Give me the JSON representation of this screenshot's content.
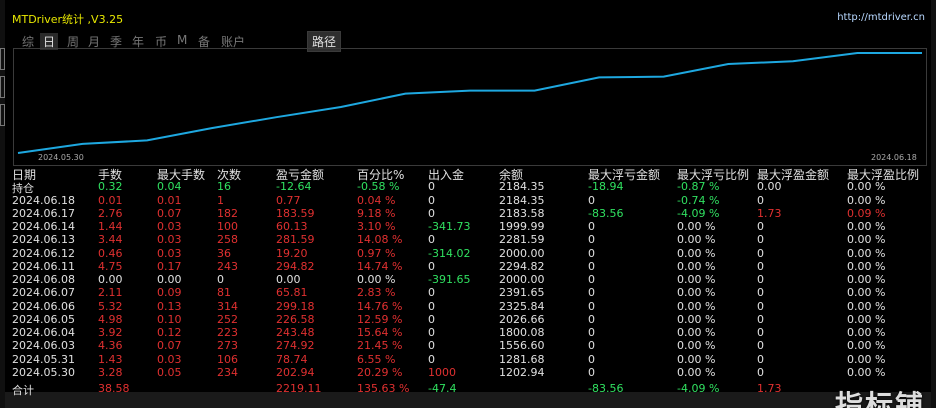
{
  "window": {
    "title": "MTDriver统计 ,V3.25",
    "url": "http://mtdriver.cn"
  },
  "periods": [
    {
      "label": "综",
      "active": false
    },
    {
      "label": "日",
      "active": true
    },
    {
      "label": "周",
      "active": false
    },
    {
      "label": "月",
      "active": false
    },
    {
      "label": "季",
      "active": false
    },
    {
      "label": "年",
      "active": false
    },
    {
      "label": "币",
      "active": false
    },
    {
      "label": "M",
      "active": false
    },
    {
      "label": "备",
      "active": false
    },
    {
      "label": "账户",
      "active": false
    }
  ],
  "path_label": "路径",
  "colors": {
    "line": "#1ea8e0",
    "profit": "#e03030",
    "loss": "#30e060",
    "neutral": "#e0e0e0"
  },
  "chart_data": {
    "type": "line",
    "x_start_label": "2024.05.30",
    "x_end_label": "2024.06.18",
    "series": [
      {
        "x": [
          "2024.05.30",
          "2024.05.31",
          "2024.06.03",
          "2024.06.04",
          "2024.06.05",
          "2024.06.06",
          "2024.06.07",
          "2024.06.08",
          "2024.06.11",
          "2024.06.12",
          "2024.06.13",
          "2024.06.14",
          "2024.06.17",
          "2024.06.18"
        ],
        "values": [
          1202.94,
          1281.68,
          1556.6,
          1800.08,
          2026.66,
          2325.84,
          2391.65,
          2000.0,
          2294.82,
          2000.0,
          2281.59,
          1999.99,
          2183.58,
          2184.35
        ]
      }
    ]
  },
  "table": {
    "headers": [
      "日期",
      "手数",
      "最大手数",
      "次数",
      "盈亏金额",
      "百分比%",
      "出入金",
      "余额",
      "最大浮亏金额",
      "最大浮亏比例",
      "最大浮盈金额",
      "最大浮盈比例"
    ],
    "holding": {
      "label": "持仓",
      "cells": [
        "0.32",
        "0.04",
        "16",
        "-12.64",
        "-0.58 %",
        "0",
        "2184.35",
        "-18.94",
        "-0.87 %",
        "0.00",
        "0.00 %"
      ]
    },
    "rows": [
      {
        "date": "2024.06.18",
        "cells": [
          "0.01",
          "0.01",
          "1",
          "0.77",
          "0.04 %",
          "0",
          "2184.35",
          "0",
          "-0.74 %",
          "0",
          "0.00 %"
        ]
      },
      {
        "date": "2024.06.17",
        "cells": [
          "2.76",
          "0.07",
          "182",
          "183.59",
          "9.18 %",
          "0",
          "2183.58",
          "-83.56",
          "-4.09 %",
          "1.73",
          "0.09 %"
        ]
      },
      {
        "date": "2024.06.14",
        "cells": [
          "1.44",
          "0.03",
          "100",
          "60.13",
          "3.10 %",
          "-341.73",
          "1999.99",
          "0",
          "0.00 %",
          "0",
          "0.00 %"
        ]
      },
      {
        "date": "2024.06.13",
        "cells": [
          "3.44",
          "0.03",
          "258",
          "281.59",
          "14.08 %",
          "0",
          "2281.59",
          "0",
          "0.00 %",
          "0",
          "0.00 %"
        ]
      },
      {
        "date": "2024.06.12",
        "cells": [
          "0.46",
          "0.03",
          "36",
          "19.20",
          "0.97 %",
          "-314.02",
          "2000.00",
          "0",
          "0.00 %",
          "0",
          "0.00 %"
        ]
      },
      {
        "date": "2024.06.11",
        "cells": [
          "4.75",
          "0.17",
          "243",
          "294.82",
          "14.74 %",
          "0",
          "2294.82",
          "0",
          "0.00 %",
          "0",
          "0.00 %"
        ]
      },
      {
        "date": "2024.06.08",
        "cells": [
          "0.00",
          "0.00",
          "0",
          "0.00",
          "0.00 %",
          "-391.65",
          "2000.00",
          "0",
          "0.00 %",
          "0",
          "0.00 %"
        ]
      },
      {
        "date": "2024.06.07",
        "cells": [
          "2.11",
          "0.09",
          "81",
          "65.81",
          "2.83 %",
          "0",
          "2391.65",
          "0",
          "0.00 %",
          "0",
          "0.00 %"
        ]
      },
      {
        "date": "2024.06.06",
        "cells": [
          "5.32",
          "0.13",
          "314",
          "299.18",
          "14.76 %",
          "0",
          "2325.84",
          "0",
          "0.00 %",
          "0",
          "0.00 %"
        ]
      },
      {
        "date": "2024.06.05",
        "cells": [
          "4.98",
          "0.10",
          "252",
          "226.58",
          "12.59 %",
          "0",
          "2026.66",
          "0",
          "0.00 %",
          "0",
          "0.00 %"
        ]
      },
      {
        "date": "2024.06.04",
        "cells": [
          "3.92",
          "0.12",
          "223",
          "243.48",
          "15.64 %",
          "0",
          "1800.08",
          "0",
          "0.00 %",
          "0",
          "0.00 %"
        ]
      },
      {
        "date": "2024.06.03",
        "cells": [
          "4.36",
          "0.07",
          "273",
          "274.92",
          "21.45 %",
          "0",
          "1556.60",
          "0",
          "0.00 %",
          "0",
          "0.00 %"
        ]
      },
      {
        "date": "2024.05.31",
        "cells": [
          "1.43",
          "0.03",
          "106",
          "78.74",
          "6.55 %",
          "0",
          "1281.68",
          "0",
          "0.00 %",
          "0",
          "0.00 %"
        ]
      },
      {
        "date": "2024.05.30",
        "cells": [
          "3.28",
          "0.05",
          "234",
          "202.94",
          "20.29 %",
          "1000",
          "1202.94",
          "0",
          "0.00 %",
          "0",
          "0.00 %"
        ]
      }
    ],
    "total": {
      "label": "合计",
      "cells": [
        "38.58",
        "",
        "",
        "2219.11",
        "135.63 %",
        "-47.4",
        "",
        "-83.56",
        "-4.09 %",
        "1.73",
        ""
      ]
    }
  },
  "watermark": "指标铺"
}
